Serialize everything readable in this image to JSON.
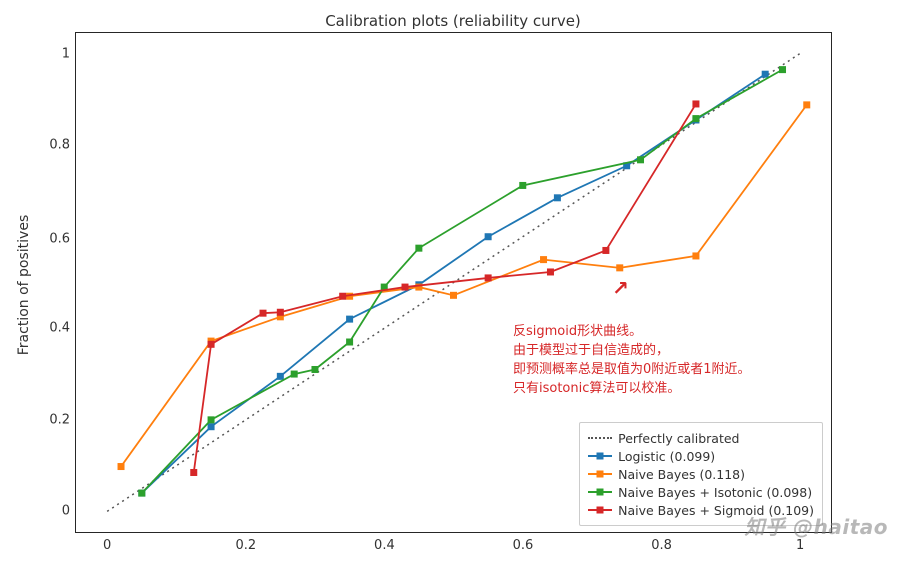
{
  "chart_data": {
    "type": "line",
    "title": "Calibration plots  (reliability curve)",
    "xlabel": "",
    "ylabel": "Fraction of positives",
    "xlim": [
      -0.045,
      1.045
    ],
    "ylim": [
      -0.045,
      1.045
    ],
    "xticks": [
      0.0,
      0.2,
      0.4,
      0.6,
      0.8,
      1.0
    ],
    "yticks": [
      0.0,
      0.2,
      0.4,
      0.6,
      0.8,
      1.0
    ],
    "series": [
      {
        "name": "Perfectly calibrated",
        "style": "dotted",
        "color": "#555555",
        "marker": "none",
        "x": [
          0.0,
          1.0
        ],
        "y": [
          0.0,
          1.0
        ]
      },
      {
        "name": "Logistic (0.099)",
        "color": "#1f77b4",
        "marker": "square",
        "x": [
          0.05,
          0.15,
          0.25,
          0.35,
          0.45,
          0.55,
          0.65,
          0.75,
          0.85,
          0.95
        ],
        "y": [
          0.04,
          0.185,
          0.295,
          0.42,
          0.495,
          0.6,
          0.685,
          0.755,
          0.855,
          0.955
        ]
      },
      {
        "name": "Naive Bayes (0.118)",
        "color": "#ff7f0e",
        "marker": "square",
        "x": [
          0.02,
          0.15,
          0.25,
          0.35,
          0.45,
          0.5,
          0.63,
          0.74,
          0.85,
          1.01
        ],
        "y": [
          0.098,
          0.372,
          0.425,
          0.47,
          0.49,
          0.472,
          0.55,
          0.532,
          0.558,
          0.888
        ]
      },
      {
        "name": "Naive Bayes + Isotonic (0.098)",
        "color": "#2ca02c",
        "marker": "square",
        "x": [
          0.05,
          0.15,
          0.27,
          0.3,
          0.35,
          0.4,
          0.45,
          0.6,
          0.77,
          0.85,
          0.975
        ],
        "y": [
          0.04,
          0.2,
          0.3,
          0.31,
          0.37,
          0.49,
          0.575,
          0.712,
          0.768,
          0.858,
          0.965
        ]
      },
      {
        "name": "Naive Bayes + Sigmoid (0.109)",
        "color": "#d62728",
        "marker": "square",
        "x": [
          0.125,
          0.15,
          0.225,
          0.25,
          0.34,
          0.43,
          0.55,
          0.64,
          0.72,
          0.85
        ],
        "y": [
          0.085,
          0.365,
          0.433,
          0.435,
          0.47,
          0.49,
          0.51,
          0.523,
          0.57,
          0.89
        ]
      }
    ]
  },
  "annotation": {
    "line1": "反sigmoid形状曲线。",
    "line2": "由于模型过于自信造成的，",
    "line3": "即预测概率总是取值为0附近或者1附近。",
    "line4": "只有isotonic算法可以校准。"
  },
  "watermark": "知乎 @haitao"
}
